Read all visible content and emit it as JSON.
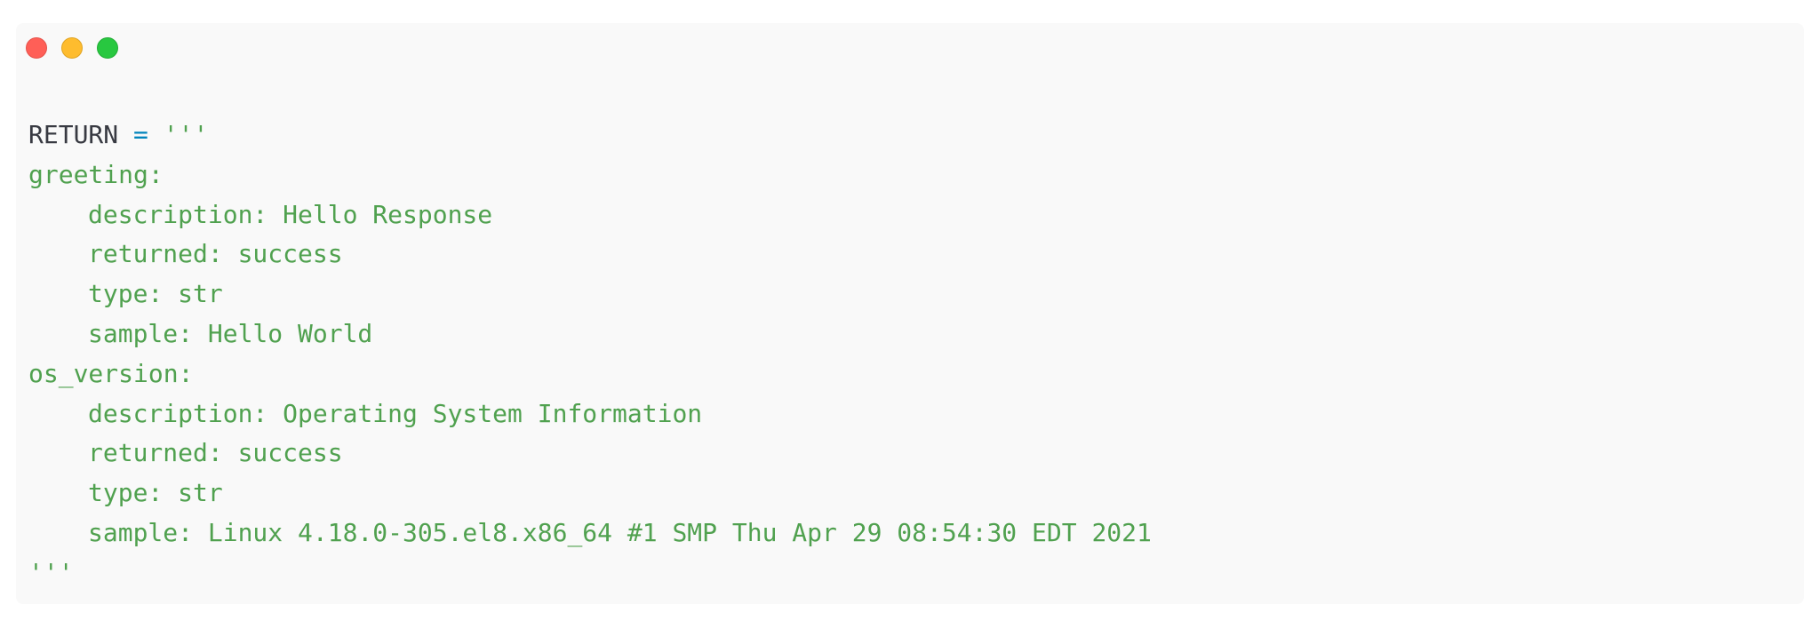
{
  "window": {
    "controls": [
      "close",
      "minimize",
      "maximize"
    ],
    "colors": {
      "close": "#ff5f57",
      "minimize": "#febc2e",
      "maximize": "#28c840",
      "background": "#f9f9f9"
    }
  },
  "code": {
    "language": "python",
    "colors": {
      "identifier": "#383a42",
      "operator": "#0184bc",
      "string": "#50a14f"
    },
    "assignment": {
      "name": "RETURN",
      "operator": "=",
      "quote_open": "'''"
    },
    "lines": [
      "greeting:",
      "description: Hello Response",
      "returned: success",
      "type: str",
      "sample: Hello World",
      "os_version:",
      "description: Operating System Information",
      "returned: success",
      "type: str",
      "sample: Linux 4.18.0-305.el8.x86_64 #1 SMP Thu Apr 29 08:54:30 EDT 2021"
    ],
    "quote_close": "'''"
  }
}
